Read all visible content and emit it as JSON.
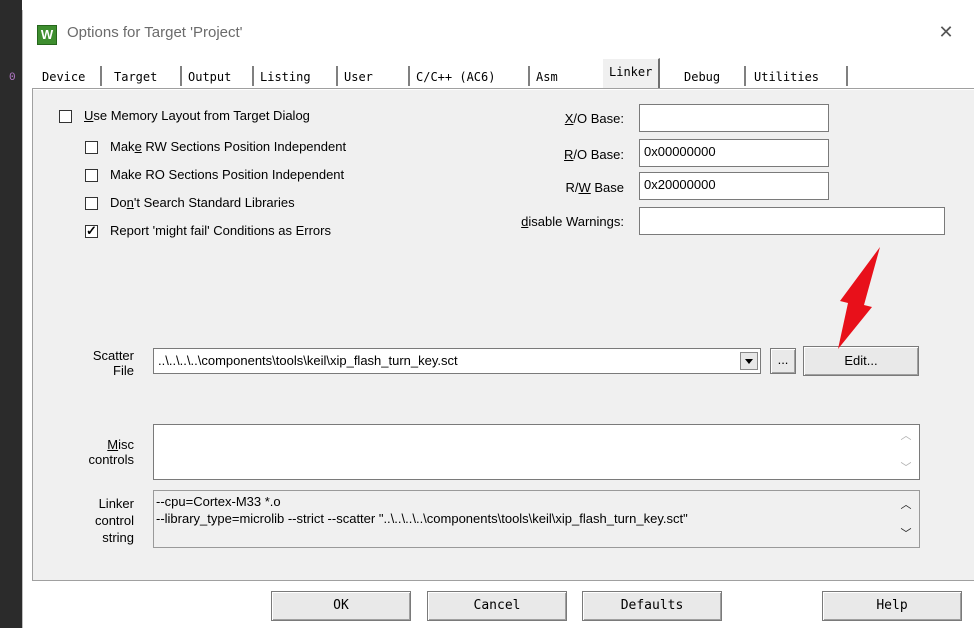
{
  "window": {
    "title": "Options for Target 'Project'",
    "close_glyph": "✕",
    "app_icon_letter": "W"
  },
  "tabs": [
    {
      "label": "Device"
    },
    {
      "label": "Target"
    },
    {
      "label": "Output"
    },
    {
      "label": "Listing"
    },
    {
      "label": "User"
    },
    {
      "label": "C/C++ (AC6)"
    },
    {
      "label": "Asm"
    },
    {
      "label": "Linker",
      "active": true
    },
    {
      "label": "Debug"
    },
    {
      "label": "Utilities"
    }
  ],
  "options": {
    "use_memory_layout": {
      "pre": "",
      "u": "U",
      "post": "se Memory Layout from Target Dialog",
      "checked": false
    },
    "make_rw": {
      "pre": "Mak",
      "u": "e",
      "post": " RW Sections Position Independent",
      "checked": false
    },
    "make_ro": {
      "pre": "Make",
      "u": "",
      "post": " RO Sections Position Independent",
      "checked": false
    },
    "dont_search": {
      "pre": "Do",
      "u": "n",
      "post": "'t Search Standard Libraries",
      "checked": false
    },
    "report_might_fail": {
      "pre": "",
      "u": "",
      "post": "Report 'might fail' Conditions as Errors",
      "checked": true
    }
  },
  "bases": {
    "xo_label_u": "X",
    "xo_label_rest": "/O Base:",
    "xo_value": "",
    "ro_label_u": "R",
    "ro_label_rest": "/O Base:",
    "ro_value": "0x00000000",
    "rw_label_pre": "R/",
    "rw_label_u": "W",
    "rw_label_rest": " Base",
    "rw_value": "0x20000000",
    "warn_label_u": "d",
    "warn_label_rest": "isable Warnings:",
    "warn_value": ""
  },
  "scatter": {
    "label_line1": "Scatter",
    "label_line2": "File",
    "value": "..\\..\\..\\..\\components\\tools\\keil\\xip_flash_turn_key.sct",
    "browse_label": "...",
    "edit_label": "Edit..."
  },
  "misc": {
    "label_u": "M",
    "label_rest": "isc",
    "label_line2": "controls",
    "value": ""
  },
  "linker_string": {
    "label_line1": "Linker",
    "label_line2": "control",
    "label_line3": "string",
    "line1": "--cpu=Cortex-M33 *.o",
    "line2": "--library_type=microlib --strict --scatter \"..\\..\\..\\..\\components\\tools\\keil\\xip_flash_turn_key.sct\""
  },
  "buttons": {
    "ok": "OK",
    "cancel": "Cancel",
    "defaults": "Defaults",
    "help": "Help"
  },
  "colors": {
    "annotation_arrow": "#e8101a",
    "panel_bg": "#f0f0f0",
    "icon_green": "#3e8e2f"
  },
  "icons": {
    "arrow": "red-annotation-arrow"
  }
}
